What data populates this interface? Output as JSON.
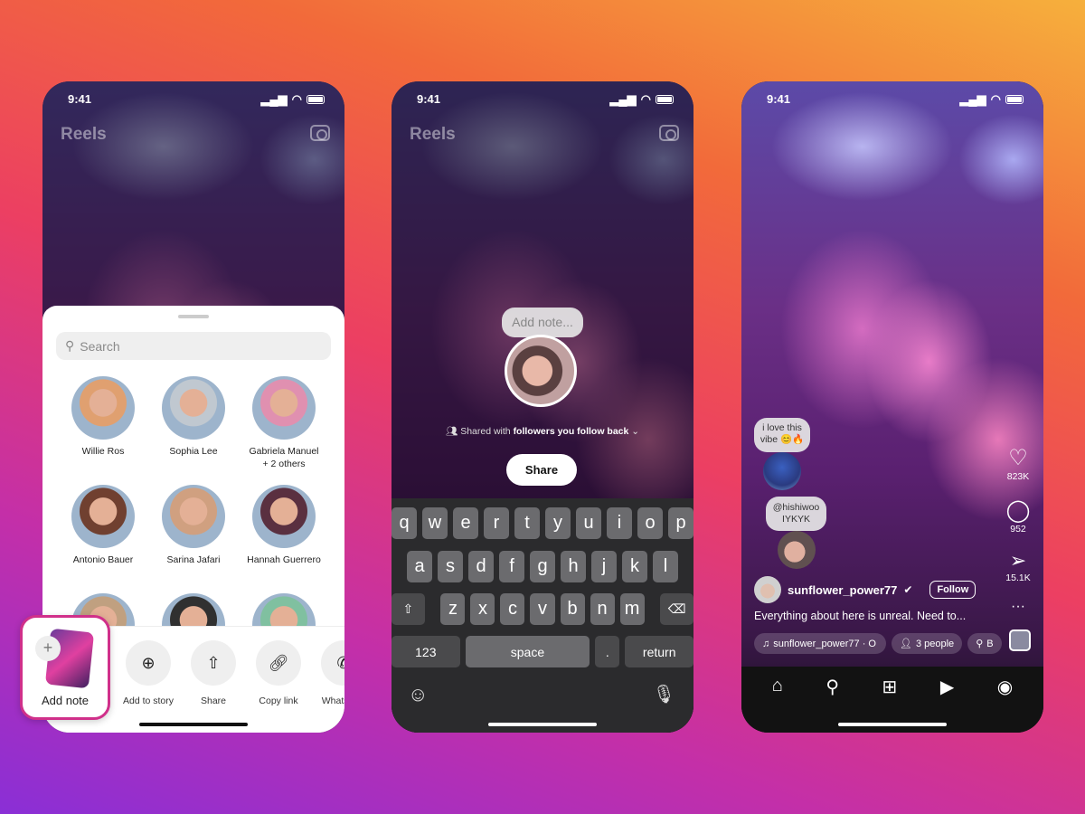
{
  "status": {
    "time": "9:41"
  },
  "phone1": {
    "title": "Reels",
    "search_placeholder": "Search",
    "contacts": [
      {
        "name": "Willie Ros"
      },
      {
        "name": "Sophia Lee"
      },
      {
        "name": "Gabriela Manuel\n+ 2 others"
      },
      {
        "name": "Antonio Bauer"
      },
      {
        "name": "Sarina Jafari"
      },
      {
        "name": "Hannah Guerrero"
      },
      {
        "name": ""
      },
      {
        "name": ""
      },
      {
        "name": ""
      }
    ],
    "actions": [
      {
        "label": "Add to story",
        "icon": "add-story-icon"
      },
      {
        "label": "Share",
        "icon": "share-icon"
      },
      {
        "label": "Copy link",
        "icon": "link-icon"
      },
      {
        "label": "WhatsApp",
        "icon": "whatsapp-icon"
      }
    ],
    "add_note": "Add note"
  },
  "phone2": {
    "title": "Reels",
    "note_placeholder": "Add note...",
    "shared_prefix": "Shared with ",
    "shared_audience": "followers you follow back",
    "share_button": "Share",
    "keyboard": {
      "row1": [
        "q",
        "w",
        "e",
        "r",
        "t",
        "y",
        "u",
        "i",
        "o",
        "p"
      ],
      "row2": [
        "a",
        "s",
        "d",
        "f",
        "g",
        "h",
        "j",
        "k",
        "l"
      ],
      "row3": [
        "z",
        "x",
        "c",
        "v",
        "b",
        "n",
        "m"
      ],
      "numbers": "123",
      "space": "space",
      "period": ".",
      "return": "return"
    }
  },
  "phone3": {
    "notes": [
      {
        "text": "i love this vibe 😊🔥"
      },
      {
        "text": "@hishiwoo IYKYK"
      }
    ],
    "likes": "823K",
    "comments": "952",
    "shares": "15.1K",
    "username": "sunflower_power77",
    "follow": "Follow",
    "caption": "Everything about here is unreal. Need to...",
    "audio": "sunflower_power77 · O",
    "people": "3 people",
    "location": "B",
    "nav": [
      "home-icon",
      "search-icon",
      "create-icon",
      "reels-icon",
      "profile-icon"
    ]
  },
  "colors": {
    "note_border": "#d0308a",
    "keyboard_bg": "#2b2b2d"
  }
}
